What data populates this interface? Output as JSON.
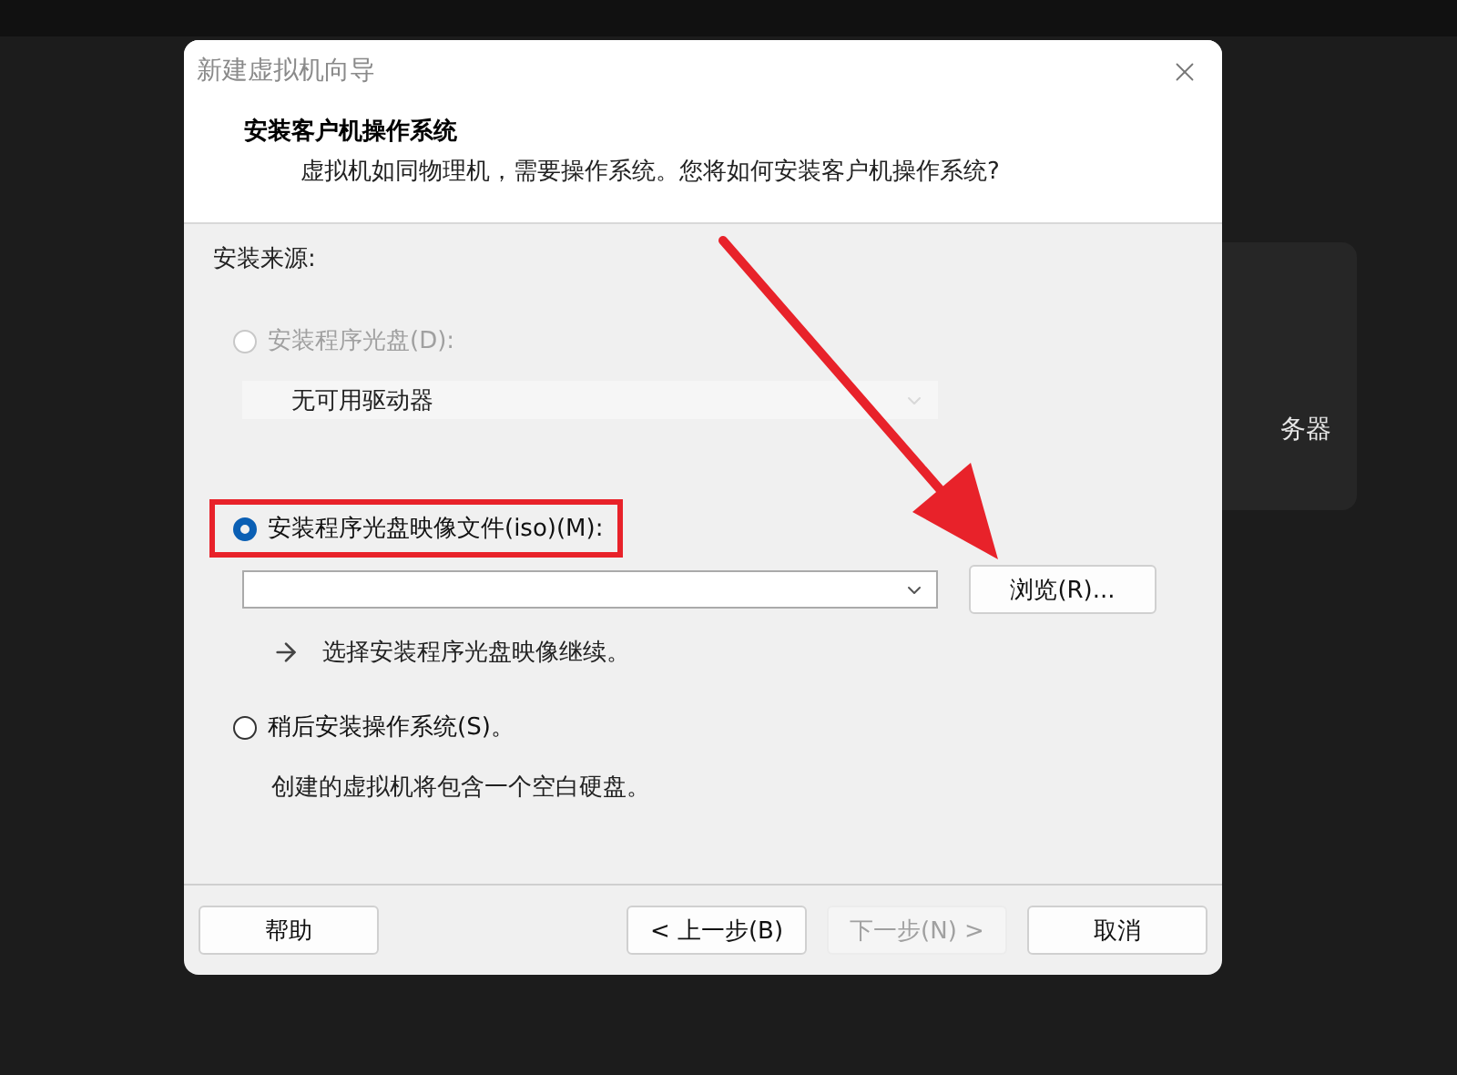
{
  "background_panel": {
    "text": "务器"
  },
  "dialog": {
    "title": "新建虚拟机向导",
    "header": {
      "title": "安装客户机操作系统",
      "subtitle": "虚拟机如同物理机，需要操作系统。您将如何安装客户机操作系统?"
    },
    "source_label": "安装来源:",
    "options": [
      {
        "kind": "disc",
        "label": "安装程序光盘(D):",
        "selected": false,
        "disabled": true,
        "highlighted": false,
        "dropdown": {
          "value": "无可用驱动器",
          "disabled": true
        }
      },
      {
        "kind": "iso",
        "label": "安装程序光盘映像文件(iso)(M):",
        "selected": true,
        "disabled": false,
        "highlighted": true,
        "browse_button": "浏览(R)...",
        "hint": "选择安装程序光盘映像继续。"
      },
      {
        "kind": "later",
        "label": "稍后安装操作系统(S)。",
        "selected": false,
        "disabled": false,
        "highlighted": false,
        "note": "创建的虚拟机将包含一个空白硬盘。"
      }
    ],
    "buttons": [
      {
        "label": "帮助",
        "disabled": false
      },
      {
        "label": "< 上一步(B)",
        "disabled": false
      },
      {
        "label": "下一步(N) >",
        "disabled": true
      },
      {
        "label": "取消",
        "disabled": false
      }
    ],
    "pointer_arrow": true
  }
}
